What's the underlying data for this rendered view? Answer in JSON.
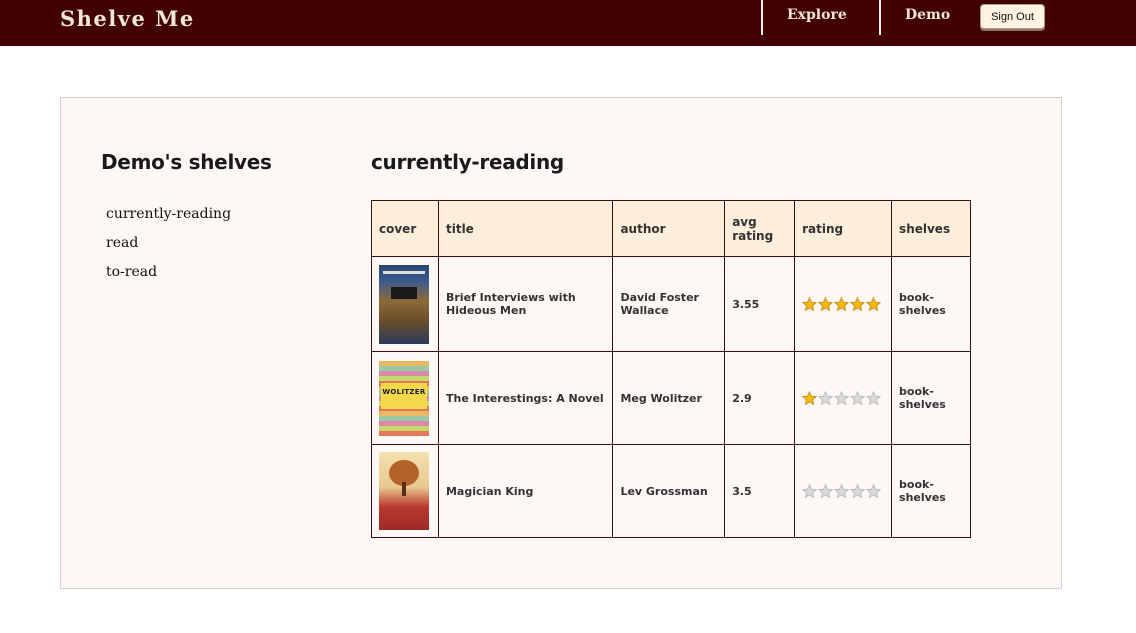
{
  "header": {
    "brand": "Shelve Me",
    "nav": [
      "Explore",
      "Demo"
    ],
    "sign_out": "Sign Out"
  },
  "sidebar": {
    "title": "Demo's shelves",
    "shelves": [
      "currently-reading",
      "read",
      "to-read"
    ]
  },
  "main": {
    "title": "currently-reading",
    "columns": [
      "cover",
      "title",
      "author",
      "avg rating",
      "rating",
      "shelves"
    ],
    "books": [
      {
        "cover": "book-cover-icon",
        "title": "Brief Interviews with Hideous Men",
        "author": "David Foster Wallace",
        "avg_rating": "3.55",
        "rating": 5,
        "shelves": "book-shelves"
      },
      {
        "cover": "book-cover-icon",
        "title": "The Interestings: A Novel",
        "author": "Meg Wolitzer",
        "avg_rating": "2.9",
        "rating": 1,
        "shelves": "book-shelves",
        "cover_text": "WOLITZER"
      },
      {
        "cover": "book-cover-icon",
        "title": "Magician King",
        "author": "Lev Grossman",
        "avg_rating": "3.5",
        "rating": 0,
        "shelves": "book-shelves"
      }
    ]
  },
  "colors": {
    "header_bg": "#420000",
    "star_filled": "#f2b91c",
    "star_empty": "#d8d8d8"
  }
}
